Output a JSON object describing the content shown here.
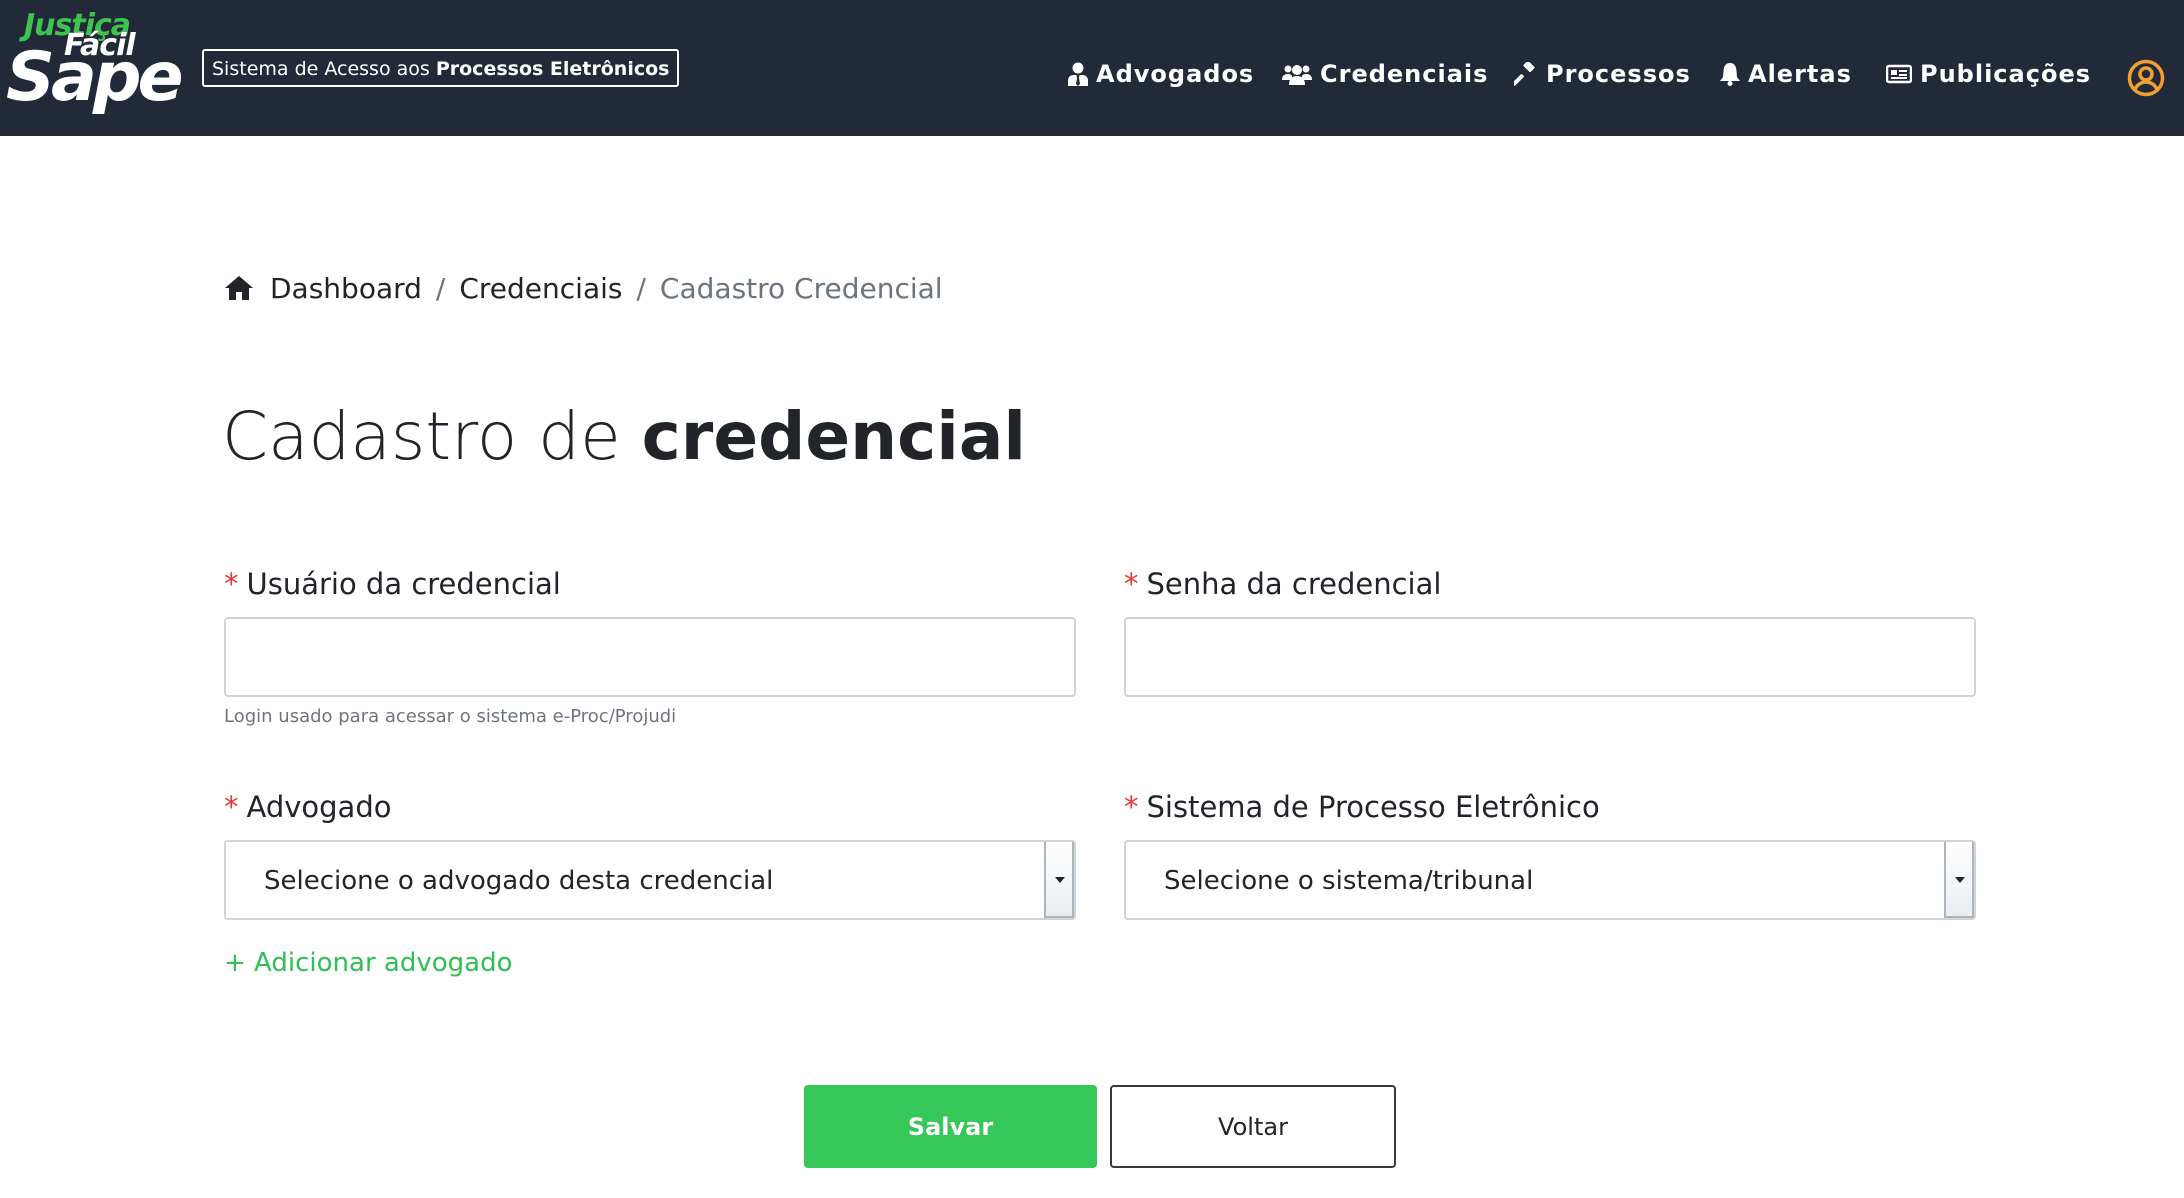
{
  "header": {
    "logo": {
      "line1": "Justiça",
      "line2": "Fácil",
      "line3": "Sape"
    },
    "tagline_prefix": "Sistema de Acesso aos ",
    "tagline_bold": "Processos Eletrônicos",
    "nav": [
      {
        "label": "Advogados",
        "icon": "user-tie-icon"
      },
      {
        "label": "Credenciais",
        "icon": "users-icon"
      },
      {
        "label": "Processos",
        "icon": "gavel-icon"
      },
      {
        "label": "Alertas",
        "icon": "bell-icon"
      },
      {
        "label": "Publicações",
        "icon": "newspaper-icon"
      }
    ],
    "user_icon": "user-circle-icon"
  },
  "breadcrumb": {
    "home_icon": "home-icon",
    "items": [
      "Dashboard",
      "Credenciais"
    ],
    "separator": "/",
    "current": "Cadastro Credencial"
  },
  "title": {
    "light": "Cadastro de ",
    "bold": "credencial"
  },
  "form": {
    "required_mark": "*",
    "usuario": {
      "label": "Usuário da credencial",
      "value": "",
      "hint": "Login usado para acessar o sistema e-Proc/Projudi"
    },
    "senha": {
      "label": "Senha da credencial",
      "value": ""
    },
    "advogado": {
      "label": "Advogado",
      "selected": "Selecione o advogado desta credencial"
    },
    "sistema": {
      "label": "Sistema de Processo Eletrônico",
      "selected": "Selecione o sistema/tribunal"
    },
    "add_advogado": "+ Adicionar advogado"
  },
  "actions": {
    "save": "Salvar",
    "back": "Voltar"
  },
  "colors": {
    "header_bg": "#222a3a",
    "accent_green": "#35c758",
    "link_green": "#2fbf52",
    "required_red": "#e53935",
    "user_icon_orange": "#f0a030"
  }
}
